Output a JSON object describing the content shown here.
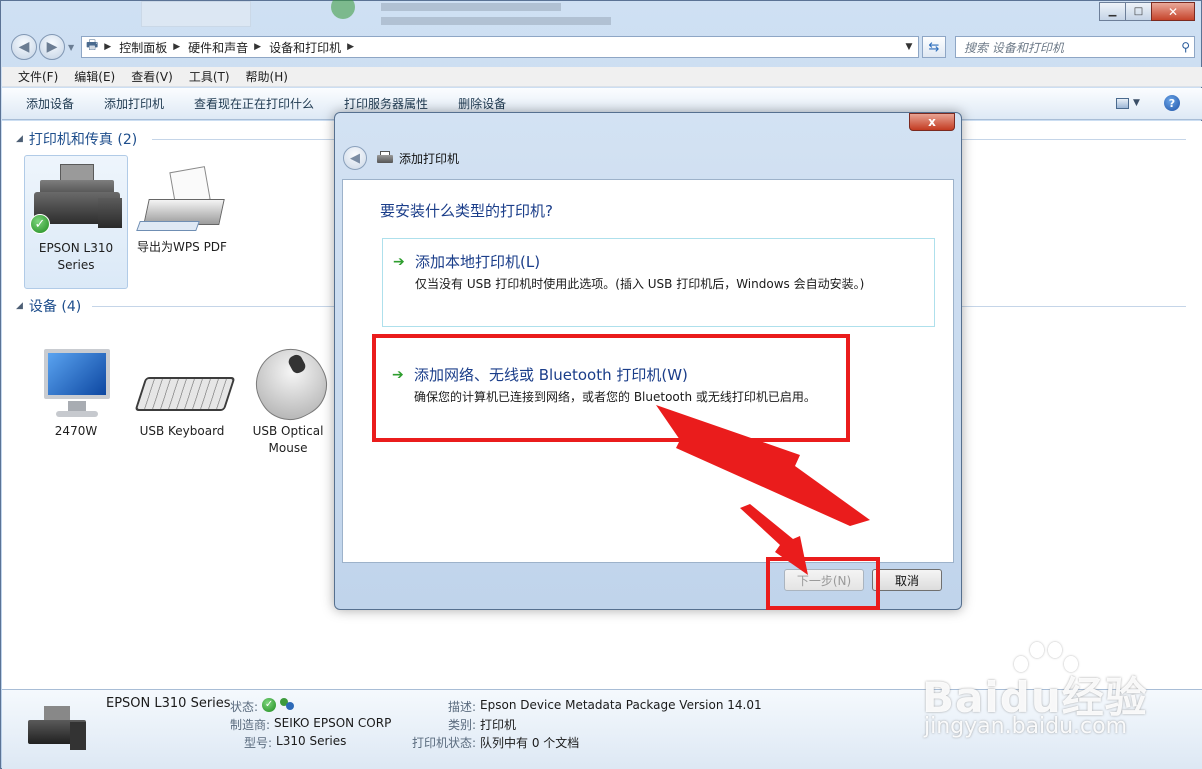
{
  "window": {
    "controls": {
      "minimize": "▁",
      "maximize": "□",
      "close": "✕"
    }
  },
  "address": {
    "crumbs": [
      "控制面板",
      "硬件和声音",
      "设备和打印机"
    ],
    "search_placeholder": "搜索 设备和打印机"
  },
  "menu": [
    "文件(F)",
    "编辑(E)",
    "查看(V)",
    "工具(T)",
    "帮助(H)"
  ],
  "commands": [
    "添加设备",
    "添加打印机",
    "查看现在正在打印什么",
    "打印服务器属性",
    "删除设备"
  ],
  "groups": {
    "printers": {
      "title": "打印机和传真 (2)",
      "items": [
        {
          "label": "EPSON L310 Series"
        },
        {
          "label": "导出为WPS PDF"
        }
      ]
    },
    "devices": {
      "title": "设备 (4)",
      "items": [
        {
          "label": "2470W"
        },
        {
          "label": "USB Keyboard"
        },
        {
          "label": "USB Optical Mouse"
        }
      ]
    }
  },
  "details": {
    "name": "EPSON L310 Series",
    "status_label": "状态:",
    "maker_label": "制造商:",
    "maker": "SEIKO EPSON CORP",
    "model_label": "型号:",
    "model": "L310 Series",
    "desc_label": "描述:",
    "desc": "Epson Device Metadata Package Version 14.01",
    "category_label": "类别:",
    "category": "打印机",
    "printer_status_label": "打印机状态:",
    "printer_status": "队列中有 0 个文档"
  },
  "dialog": {
    "title": "添加打印机",
    "question": "要安装什么类型的打印机?",
    "option_local": {
      "title": "添加本地打印机(L)",
      "desc": "仅当没有 USB 打印机时使用此选项。(插入 USB 打印机后，Windows 会自动安装。)"
    },
    "option_network": {
      "title": "添加网络、无线或 Bluetooth 打印机(W)",
      "desc": "确保您的计算机已连接到网络，或者您的 Bluetooth 或无线打印机已启用。"
    },
    "next_label": "下一步(N)",
    "cancel_label": "取消",
    "close_glyph": "x"
  },
  "watermark": {
    "logo": "Baidu经验",
    "url": "jingyan.baidu.com"
  },
  "colors": {
    "annotation_red": "#ea1c1c",
    "link_blue": "#1b3e8a",
    "arrow_green": "#2f9e2f"
  }
}
